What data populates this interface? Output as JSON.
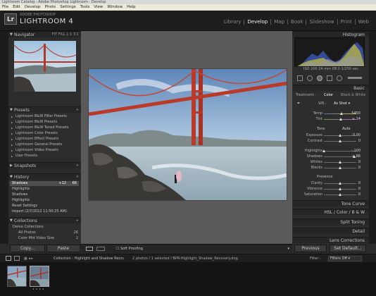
{
  "window": {
    "title": "Lightroom Catalog - Adobe Photoshop Lightroom - Develop"
  },
  "menu": [
    "File",
    "Edit",
    "Develop",
    "Photo",
    "Settings",
    "Tools",
    "View",
    "Window",
    "Help"
  ],
  "identity": {
    "badge": "Lr",
    "sub": "ADOBE PHOTOSHOP",
    "name": "LIGHTROOM 4"
  },
  "modules": [
    {
      "label": "Library",
      "active": false
    },
    {
      "label": "Develop",
      "active": true
    },
    {
      "label": "Map",
      "active": false
    },
    {
      "label": "Book",
      "active": false
    },
    {
      "label": "Slideshow",
      "active": false
    },
    {
      "label": "Print",
      "active": false
    },
    {
      "label": "Web",
      "active": false
    }
  ],
  "left": {
    "navigator": {
      "title": "Navigator",
      "zoom": "FIT  FILL  1:1  3:1"
    },
    "presets": {
      "title": "Presets",
      "items": [
        "Lightroom B&W Filter Presets",
        "Lightroom B&W Presets",
        "Lightroom B&W Toned Presets",
        "Lightroom Color Presets",
        "Lightroom Effect Presets",
        "Lightroom General Presets",
        "Lightroom Video Presets",
        "User Presets"
      ]
    },
    "snapshots": {
      "title": "Snapshots"
    },
    "history": {
      "title": "History",
      "items": [
        {
          "label": "Shadows",
          "v1": "+12",
          "v2": "66",
          "selected": true
        },
        {
          "label": "Highlights",
          "v1": "",
          "v2": "",
          "selected": false
        },
        {
          "label": "Shadows",
          "v1": "",
          "v2": "",
          "selected": false
        },
        {
          "label": "Highlights",
          "v1": "",
          "v2": "",
          "selected": false
        },
        {
          "label": "Reset Settings",
          "v1": "",
          "v2": "",
          "selected": false
        },
        {
          "label": "Import (2/7/2012 11:50:25 AM)",
          "v1": "",
          "v2": "",
          "selected": false
        }
      ]
    },
    "collections": {
      "title": "Collections",
      "items": [
        {
          "label": "Demo Collections",
          "count": ""
        },
        {
          "label": "All Photos",
          "count": "26"
        },
        {
          "label": "Color Mid Video Size",
          "count": "2"
        }
      ]
    },
    "copy": "Copy...",
    "paste": "Paste"
  },
  "toolbar": {
    "soft_proofing": "Soft Proofing"
  },
  "right": {
    "histogram": {
      "title": "Histogram",
      "info": "ISO 200    24 mm    f/8.0    1/250 sec"
    },
    "basic": {
      "title": "Basic",
      "treatment_label": "Treatment :",
      "treatment_color": "Color",
      "treatment_bw": "Black & White",
      "wb_label": "WB :",
      "wb_value": "As Shot",
      "sliders": [
        {
          "label": "Temp",
          "value": "5450",
          "pos": 0.55
        },
        {
          "label": "Tint",
          "value": "+ 14",
          "pos": 0.52
        },
        {
          "label": "Exposure",
          "value": "0.00",
          "pos": 0.5
        },
        {
          "label": "Contrast",
          "value": "0",
          "pos": 0.5
        },
        {
          "label": "Highlights",
          "value": "- 100",
          "pos": 0.0
        },
        {
          "label": "Shadows",
          "value": "+ 88",
          "pos": 0.94
        },
        {
          "label": "Whites",
          "value": "0",
          "pos": 0.5
        },
        {
          "label": "Blacks",
          "value": "0",
          "pos": 0.5
        },
        {
          "label": "Clarity",
          "value": "0",
          "pos": 0.5
        },
        {
          "label": "Vibrance",
          "value": "0",
          "pos": 0.5
        },
        {
          "label": "Saturation",
          "value": "0",
          "pos": 0.5
        }
      ],
      "tone_label": "Tone",
      "auto": "Auto",
      "presence_label": "Presence"
    },
    "panels": [
      "Tone Curve",
      "HSL  /  Color  /  B & W",
      "Split Toning",
      "Detail",
      "Lens Corrections"
    ],
    "previous": "Previous",
    "reset": "Set Default..."
  },
  "filmstrip": {
    "path": "Collection : Highlight and Shadow Recovery",
    "count": "2 photos / 1 selected / BPR-Highlight_Shadow_Recovery.dng",
    "filter_label": "Filter :",
    "filter_value": "Filters Off"
  }
}
